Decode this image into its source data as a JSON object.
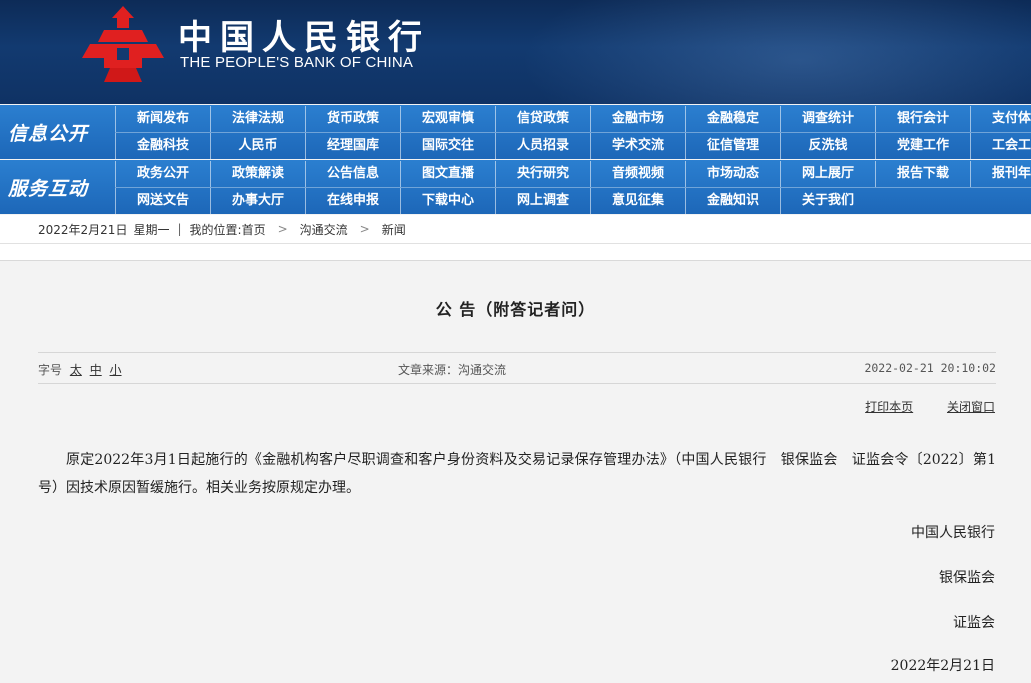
{
  "header": {
    "bank_name_cn": "中国人民银行",
    "bank_name_en": "THE PEOPLE'S BANK OF CHINA",
    "logo_icon": "pboc-logo-icon",
    "colors": {
      "banner": "#0f3264",
      "nav": "#1d67b8",
      "logo": "#e02020"
    }
  },
  "nav": {
    "section1": {
      "label": "信息公开",
      "row1": [
        "新闻发布",
        "法律法规",
        "货币政策",
        "宏观审慎",
        "信贷政策",
        "金融市场",
        "金融稳定",
        "调查统计",
        "银行会计",
        "支付体系"
      ],
      "row2": [
        "金融科技",
        "人民币",
        "经理国库",
        "国际交往",
        "人员招录",
        "学术交流",
        "征信管理",
        "反洗钱",
        "党建工作",
        "工会工作"
      ]
    },
    "section2": {
      "label": "服务互动",
      "row1": [
        "政务公开",
        "政策解读",
        "公告信息",
        "图文直播",
        "央行研究",
        "音频视频",
        "市场动态",
        "网上展厅",
        "报告下载",
        "报刊年鉴"
      ],
      "row2": [
        "网送文告",
        "办事大厅",
        "在线申报",
        "下载中心",
        "网上调查",
        "意见征集",
        "金融知识",
        "关于我们"
      ]
    }
  },
  "breadcrumb": {
    "date": "2022年2月21日",
    "weekday": "星期一",
    "separator": "|",
    "location_label": "我的位置:",
    "home": "首页",
    "level1": "沟通交流",
    "level2": "新闻",
    "arrow": ">"
  },
  "article": {
    "title": "公 告（附答记者问）",
    "font_size_label": "字号",
    "font_sizes": [
      "太",
      "中",
      "小"
    ],
    "source": "文章来源：沟通交流",
    "datetime": "2022-02-21 20:10:02",
    "print_label": "打印本页",
    "close_label": "关闭窗口",
    "body": "原定2022年3月1日起施行的《金融机构客户尽职调查和客户身份资料及交易记录保存管理办法》（中国人民银行　银保监会　证监会令〔2022〕第1号）因技术原因暂缓施行。相关业务按原规定办理。",
    "signatures": [
      "中国人民银行",
      "银保监会",
      "证监会"
    ],
    "sign_date": "2022年2月21日"
  }
}
